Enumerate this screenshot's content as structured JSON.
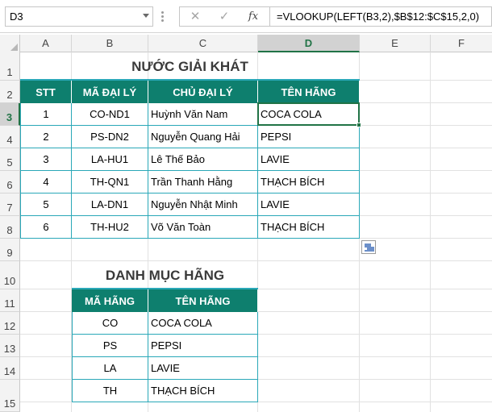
{
  "formula_bar": {
    "name_box": "D3",
    "cancel_icon": "✕",
    "enter_icon": "✓",
    "fx_label": "fx",
    "formula": "=VLOOKUP(LEFT(B3,2),$B$12:$C$15,2,0)"
  },
  "columns": [
    "A",
    "B",
    "C",
    "D",
    "E",
    "F"
  ],
  "rows": [
    "1",
    "2",
    "3",
    "4",
    "5",
    "6",
    "7",
    "8",
    "9",
    "10",
    "11",
    "12",
    "13",
    "14",
    "15"
  ],
  "selected": {
    "column": "D",
    "row": "3"
  },
  "table1": {
    "title": "NƯỚC GIẢI KHÁT",
    "headers": [
      "STT",
      "MÃ ĐẠI LÝ",
      "CHỦ ĐẠI LÝ",
      "TÊN HÃNG"
    ],
    "rows": [
      [
        "1",
        "CO-ND1",
        "Huỳnh Văn Nam",
        "COCA COLA"
      ],
      [
        "2",
        "PS-DN2",
        "Nguyễn Quang Hải",
        "PEPSI"
      ],
      [
        "3",
        "LA-HU1",
        "Lê Thế Bảo",
        "LAVIE"
      ],
      [
        "4",
        "TH-QN1",
        "Trần Thanh Hằng",
        "THẠCH BÍCH"
      ],
      [
        "5",
        "LA-DN1",
        "Nguyễn Nhật Minh",
        "LAVIE"
      ],
      [
        "6",
        "TH-HU2",
        "Võ Văn Toàn",
        "THẠCH BÍCH"
      ]
    ]
  },
  "table2": {
    "title": "DANH MỤC HÃNG",
    "headers": [
      "MÃ HÃNG",
      "TÊN HÃNG"
    ],
    "rows": [
      [
        "CO",
        "COCA COLA"
      ],
      [
        "PS",
        "PEPSI"
      ],
      [
        "LA",
        "LAVIE"
      ],
      [
        "TH",
        "THẠCH BÍCH"
      ]
    ]
  },
  "icons": {
    "paste_options": "paste-options-icon"
  },
  "colors": {
    "header_fill": "#0e7f6e",
    "border": "#2aa8b8",
    "selection": "#217346"
  }
}
